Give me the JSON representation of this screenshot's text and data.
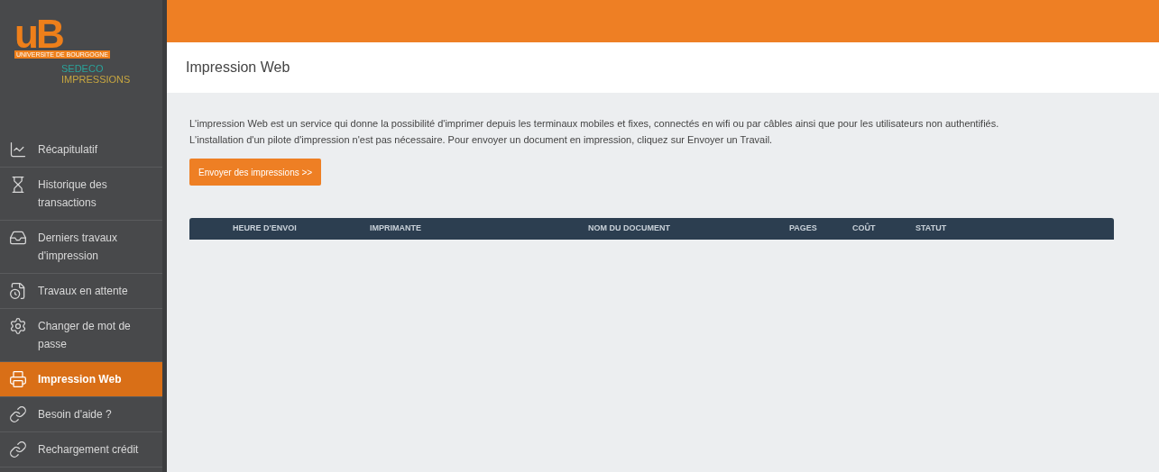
{
  "logo": {
    "mark": "uB",
    "university": "UNIVERSITE DE BOURGOGNE",
    "line_1": "SEDECO",
    "line_2": "IMPRESSIONS"
  },
  "sidebar": {
    "items": [
      {
        "label": "Récapitulatif",
        "selected": false
      },
      {
        "label": "Historique des transactions",
        "selected": false
      },
      {
        "label": "Derniers travaux d'impression",
        "selected": false
      },
      {
        "label": "Travaux en attente",
        "selected": false
      },
      {
        "label": "Changer de mot de passe",
        "selected": false
      },
      {
        "label": "Impression Web",
        "selected": true
      },
      {
        "label": "Besoin d'aide ?",
        "selected": false
      },
      {
        "label": "Rechargement crédit",
        "selected": false
      }
    ]
  },
  "page_title": "Impression Web",
  "description": [
    "L'impression Web est un service qui donne la possibilité d'imprimer depuis les terminaux mobiles et fixes, connectés en wifi ou par câbles ainsi que pour les utilisateurs non authentifiés.",
    "L'installation d'un pilote d'impression n'est pas nécessaire. Pour envoyer un document en impression, cliquez sur Envoyer un Travail."
  ],
  "send_button": "Envoyer des impressions >>",
  "table": {
    "columns": [
      "HEURE D'ENVOI",
      "IMPRIMANTE",
      "NOM DU DOCUMENT",
      "PAGES",
      "COÛT",
      "STATUT"
    ]
  }
}
